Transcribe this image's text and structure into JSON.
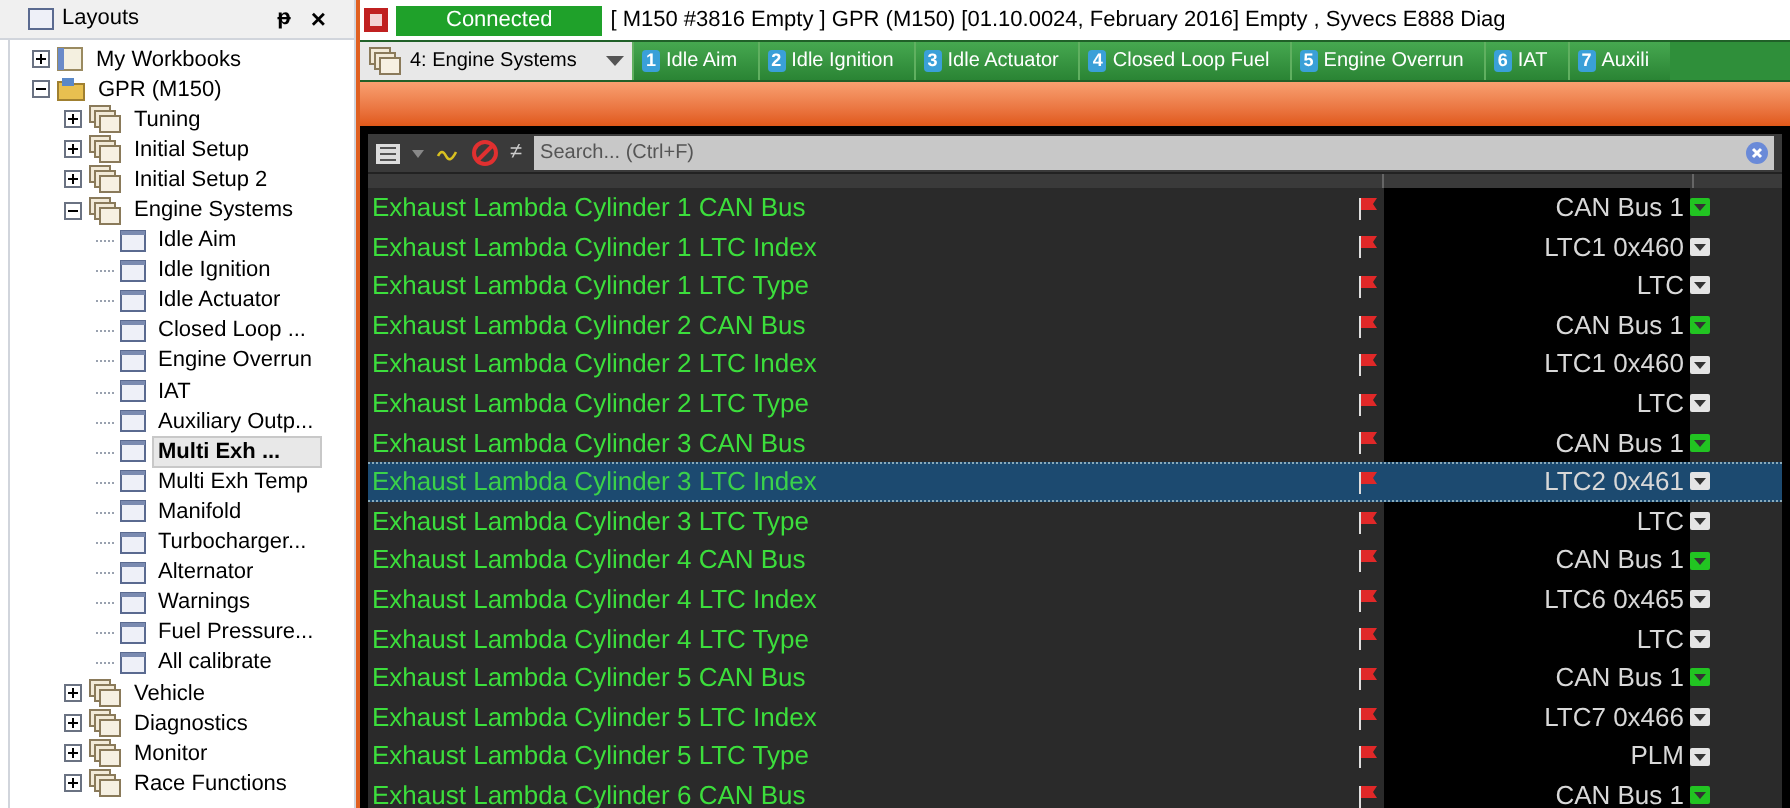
{
  "layouts_panel": {
    "title": "Layouts",
    "pin": "ᵽ",
    "close": "×"
  },
  "tree": [
    {
      "label": "My Workbooks",
      "kind": "workbook",
      "expanded": false,
      "selected": false
    },
    {
      "label": "GPR (M150)",
      "kind": "project",
      "expanded": true,
      "selected": false,
      "children": [
        {
          "label": "Tuning",
          "kind": "group",
          "expanded": false,
          "selected": false
        },
        {
          "label": "Initial Setup",
          "kind": "group",
          "expanded": false,
          "selected": false
        },
        {
          "label": "Initial Setup 2",
          "kind": "group",
          "expanded": false,
          "selected": false
        },
        {
          "label": "Engine Systems",
          "kind": "group",
          "expanded": true,
          "selected": false,
          "children": [
            {
              "label": "Idle Aim",
              "kind": "layout",
              "selected": false
            },
            {
              "label": "Idle Ignition",
              "kind": "layout",
              "selected": false
            },
            {
              "label": "Idle Actuator",
              "kind": "layout",
              "selected": false
            },
            {
              "label": "Closed Loop ...",
              "kind": "layout",
              "selected": false
            },
            {
              "label": "Engine Overrun",
              "kind": "layout",
              "selected": false
            },
            {
              "label": "IAT",
              "kind": "layout",
              "selected": false
            },
            {
              "label": "Auxiliary Outp...",
              "kind": "layout",
              "selected": false
            },
            {
              "label": "Multi Exh ...",
              "kind": "layout",
              "selected": true
            },
            {
              "label": "Multi Exh Temp",
              "kind": "layout",
              "selected": false
            },
            {
              "label": "Manifold",
              "kind": "layout",
              "selected": false
            },
            {
              "label": "Turbocharger...",
              "kind": "layout",
              "selected": false
            },
            {
              "label": "Alternator",
              "kind": "layout",
              "selected": false
            },
            {
              "label": "Warnings",
              "kind": "layout",
              "selected": false
            },
            {
              "label": "Fuel Pressure...",
              "kind": "layout",
              "selected": false
            },
            {
              "label": "All calibrate",
              "kind": "layout",
              "selected": false
            }
          ]
        },
        {
          "label": "Vehicle",
          "kind": "group",
          "expanded": false,
          "selected": false
        },
        {
          "label": "Diagnostics",
          "kind": "group",
          "expanded": false,
          "selected": false
        },
        {
          "label": "Monitor",
          "kind": "group",
          "expanded": false,
          "selected": false
        },
        {
          "label": "Race Functions",
          "kind": "group",
          "expanded": false,
          "selected": false
        }
      ]
    }
  ],
  "status": {
    "connection": "Connected",
    "info": "[ M150 #3816 Empty ]  GPR (M150) [01.10.0024, February 2016] Empty , Syvecs E888 Diag"
  },
  "layout_select": {
    "value": "4: Engine Systems"
  },
  "tabs": [
    {
      "number": "1",
      "label": "Idle Aim",
      "selected": false
    },
    {
      "number": "2",
      "label": "Idle Ignition",
      "selected": false
    },
    {
      "number": "3",
      "label": "Idle Actuator",
      "selected": false
    },
    {
      "number": "4",
      "label": "Closed Loop Fuel",
      "selected": false
    },
    {
      "number": "5",
      "label": "Engine Overrun",
      "selected": false
    },
    {
      "number": "6",
      "label": "IAT",
      "selected": false
    },
    {
      "number": "7",
      "label": "Auxili",
      "selected": false
    }
  ],
  "toolbar": {
    "not_equal": "≠",
    "search_placeholder": "Search... (Ctrl+F)"
  },
  "rows": [
    {
      "name": "Exhaust Lambda Cylinder 1 CAN Bus",
      "value": "CAN Bus 1",
      "color": "#22c422",
      "selected": false
    },
    {
      "name": "Exhaust Lambda Cylinder 1 LTC Index",
      "value": "LTC1 0x460",
      "color": "#e4e4e4",
      "selected": false
    },
    {
      "name": "Exhaust Lambda Cylinder 1 LTC Type",
      "value": "LTC",
      "color": "#e4e4e4",
      "selected": false
    },
    {
      "name": "Exhaust Lambda Cylinder 2 CAN Bus",
      "value": "CAN Bus 1",
      "color": "#22c422",
      "selected": false
    },
    {
      "name": "Exhaust Lambda Cylinder 2 LTC Index",
      "value": "LTC1 0x460",
      "color": "#e4e4e4",
      "selected": false
    },
    {
      "name": "Exhaust Lambda Cylinder 2 LTC Type",
      "value": "LTC",
      "color": "#e4e4e4",
      "selected": false
    },
    {
      "name": "Exhaust Lambda Cylinder 3 CAN Bus",
      "value": "CAN Bus 1",
      "color": "#22c422",
      "selected": false
    },
    {
      "name": "Exhaust Lambda Cylinder 3 LTC Index",
      "value": "LTC2 0x461",
      "color": "#e4e4e4",
      "selected": true
    },
    {
      "name": "Exhaust Lambda Cylinder 3 LTC Type",
      "value": "LTC",
      "color": "#e4e4e4",
      "selected": false
    },
    {
      "name": "Exhaust Lambda Cylinder 4 CAN Bus",
      "value": "CAN Bus 1",
      "color": "#22c422",
      "selected": false
    },
    {
      "name": "Exhaust Lambda Cylinder 4 LTC Index",
      "value": "LTC6 0x465",
      "color": "#e4e4e4",
      "selected": false
    },
    {
      "name": "Exhaust Lambda Cylinder 4 LTC Type",
      "value": "LTC",
      "color": "#e4e4e4",
      "selected": false
    },
    {
      "name": "Exhaust Lambda Cylinder 5 CAN Bus",
      "value": "CAN Bus 1",
      "color": "#22c422",
      "selected": false
    },
    {
      "name": "Exhaust Lambda Cylinder 5 LTC Index",
      "value": "LTC7 0x466",
      "color": "#e4e4e4",
      "selected": false
    },
    {
      "name": "Exhaust Lambda Cylinder 5 LTC Type",
      "value": "PLM",
      "color": "#e4e4e4",
      "selected": false
    },
    {
      "name": "Exhaust Lambda Cylinder 6 CAN Bus",
      "value": "CAN Bus 1",
      "color": "#22c422",
      "selected": false
    }
  ]
}
